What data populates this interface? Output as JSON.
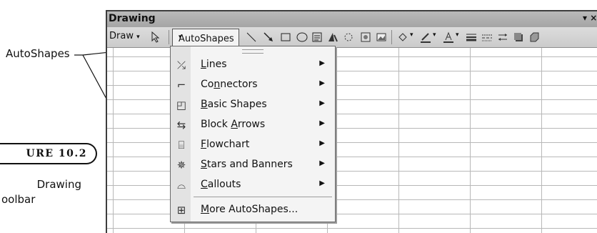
{
  "callout": {
    "label": "AutoShapes"
  },
  "figure": {
    "badge": "URE 10.2",
    "caption_line1": "Drawing",
    "caption_line2": "oolbar"
  },
  "toolbar": {
    "title": "Drawing",
    "title_controls": "▾ ×",
    "draw_label": "Draw",
    "autoshapes_label": "AutoShapes",
    "dropdown_glyph": "▾",
    "icons": [
      "line-icon",
      "arrow-icon",
      "rectangle-icon",
      "oval-icon",
      "text-box-icon",
      "wordart-icon",
      "diagram-icon",
      "clip-art-icon",
      "picture-icon",
      "fill-color-icon",
      "line-color-icon",
      "font-color-icon",
      "line-style-icon",
      "dash-style-icon",
      "arrow-style-icon",
      "shadow-icon",
      "3d-icon"
    ]
  },
  "menu": {
    "items": [
      {
        "pre": "",
        "u": "L",
        "post": "ines",
        "icon": "lines-icon",
        "glyph": "⤰",
        "submenu": true
      },
      {
        "pre": "Co",
        "u": "n",
        "post": "nectors",
        "icon": "connectors-icon",
        "glyph": "⌐",
        "submenu": true
      },
      {
        "pre": "",
        "u": "B",
        "post": "asic Shapes",
        "icon": "basic-shapes-icon",
        "glyph": "◰",
        "submenu": true
      },
      {
        "pre": "Block ",
        "u": "A",
        "post": "rrows",
        "icon": "block-arrows-icon",
        "glyph": "⇆",
        "submenu": true
      },
      {
        "pre": "",
        "u": "F",
        "post": "lowchart",
        "icon": "flowchart-icon",
        "glyph": "⌸",
        "submenu": true
      },
      {
        "pre": "",
        "u": "S",
        "post": "tars and Banners",
        "icon": "stars-banners-icon",
        "glyph": "✵",
        "submenu": true
      },
      {
        "pre": "",
        "u": "C",
        "post": "allouts",
        "icon": "callouts-icon",
        "glyph": "⌓",
        "submenu": true
      },
      {
        "pre": "",
        "u": "M",
        "post": "ore AutoShapes...",
        "icon": "more-autoshapes-icon",
        "glyph": "⊞",
        "submenu": false
      }
    ],
    "arrow": "▶"
  }
}
